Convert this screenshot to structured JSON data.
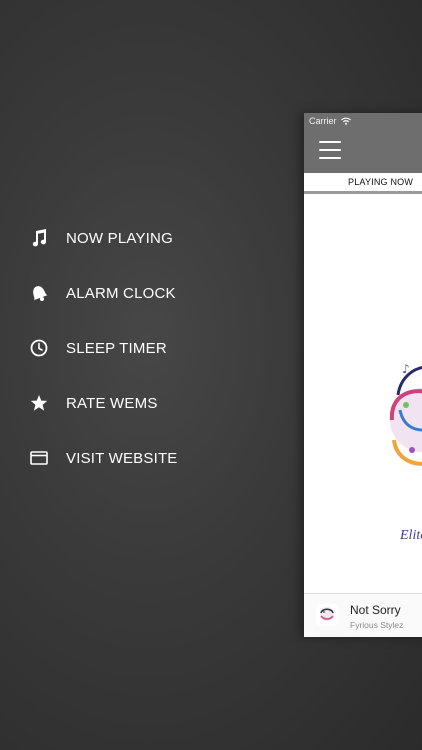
{
  "menu": {
    "items": [
      {
        "label": "NOW PLAYING",
        "icon": "music-note-icon"
      },
      {
        "label": "ALARM CLOCK",
        "icon": "bell-icon"
      },
      {
        "label": "SLEEP TIMER",
        "icon": "clock-icon"
      },
      {
        "label": "RATE WEMS",
        "icon": "star-icon"
      },
      {
        "label": "VISIT WEBSITE",
        "icon": "browser-window-icon"
      }
    ]
  },
  "statusbar": {
    "carrier": "Carrier"
  },
  "tabs": {
    "playing_now": "PLAYING NOW"
  },
  "artwork": {
    "caption": "Elite"
  },
  "player": {
    "title": "Not Sorry",
    "artist": "Fyrious Stylez"
  },
  "colors": {
    "background": "#333333",
    "navbar": "#6e6e6e",
    "text": "#ffffff"
  }
}
